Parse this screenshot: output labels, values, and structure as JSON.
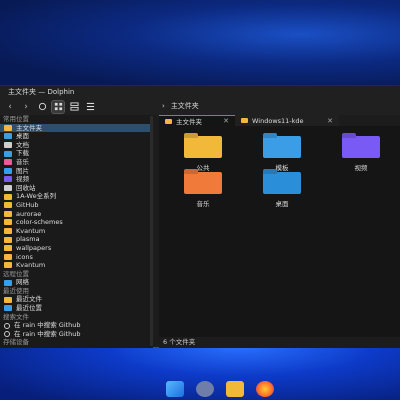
{
  "window": {
    "title": "主文件夹 — Dolphin"
  },
  "toolbar": {
    "back": "‹",
    "forward": "›",
    "breadcrumb_sep": "›",
    "breadcrumb": "主文件夹"
  },
  "sidebar": {
    "sections": {
      "places": "常用位置",
      "remote": "远程位置",
      "recent": "最近使用",
      "search": "搜索文件",
      "devices": "存储设备"
    },
    "places": [
      {
        "label": "主文件夹",
        "icon": "home-folder-icon",
        "color": "#f1b83a",
        "selected": true
      },
      {
        "label": "桌面",
        "icon": "desktop-folder-icon",
        "color": "#3b9de6"
      },
      {
        "label": "文档",
        "icon": "documents-icon",
        "color": "#cfcfcf"
      },
      {
        "label": "下载",
        "icon": "download-icon",
        "color": "#3b9de6"
      },
      {
        "label": "音乐",
        "icon": "music-icon",
        "color": "#e85c9a"
      },
      {
        "label": "图片",
        "icon": "pictures-icon",
        "color": "#3b9de6"
      },
      {
        "label": "视频",
        "icon": "videos-icon",
        "color": "#7a5af5"
      },
      {
        "label": "回收站",
        "icon": "trash-icon",
        "color": "#cfcfcf"
      },
      {
        "label": "1A-We全系列",
        "icon": "folder-icon",
        "color": "#f1b83a"
      },
      {
        "label": "GitHub",
        "icon": "folder-icon",
        "color": "#f1b83a"
      },
      {
        "label": "aurorae",
        "icon": "folder-icon",
        "color": "#f1b83a"
      },
      {
        "label": "color-schemes",
        "icon": "folder-icon",
        "color": "#f1b83a"
      },
      {
        "label": "Kvantum",
        "icon": "folder-icon",
        "color": "#f1b83a"
      },
      {
        "label": "plasma",
        "icon": "folder-icon",
        "color": "#f1b83a"
      },
      {
        "label": "wallpapers",
        "icon": "folder-icon",
        "color": "#f1b83a"
      },
      {
        "label": "icons",
        "icon": "folder-icon",
        "color": "#f1b83a"
      },
      {
        "label": "Kvantum",
        "icon": "folder-icon",
        "color": "#f1b83a"
      }
    ],
    "remote": [
      {
        "label": "网络",
        "icon": "network-icon",
        "color": "#3b9de6"
      }
    ],
    "recent": [
      {
        "label": "最近文件",
        "icon": "recent-files-icon",
        "color": "#f1b83a"
      },
      {
        "label": "最近位置",
        "icon": "recent-locations-icon",
        "color": "#3b9de6"
      }
    ],
    "search": [
      {
        "label": "在 rain 中搜索 Github",
        "icon": "search-icon"
      },
      {
        "label": "在 rain 中搜索 Github",
        "icon": "search-icon"
      }
    ]
  },
  "tabs": [
    {
      "label": "主文件夹",
      "close": "✕",
      "active": true
    },
    {
      "label": "Windows11-kde",
      "close": "✕",
      "active": false
    }
  ],
  "files": [
    {
      "name": "公共",
      "icon": "public-folder-icon",
      "color": "#f1b83a"
    },
    {
      "name": "模板",
      "icon": "templates-folder-icon",
      "color": "#3b9de6"
    },
    {
      "name": "视频",
      "icon": "videos-folder-icon",
      "color": "#7a5af5"
    },
    {
      "name": "音乐",
      "icon": "music-folder-icon",
      "color": "#f07a3a"
    },
    {
      "name": "桌面",
      "icon": "desktop-folder-icon",
      "color": "#2a8fd8"
    }
  ],
  "status": {
    "text": "6 个文件夹"
  },
  "taskbar": [
    {
      "icon": "start-icon",
      "color": "#3aa0ff"
    },
    {
      "icon": "settings-icon",
      "color": "#6e7ea8"
    },
    {
      "icon": "file-manager-icon",
      "color": "#f1b83a"
    },
    {
      "icon": "firefox-icon",
      "color": "#ff6a2a"
    }
  ]
}
